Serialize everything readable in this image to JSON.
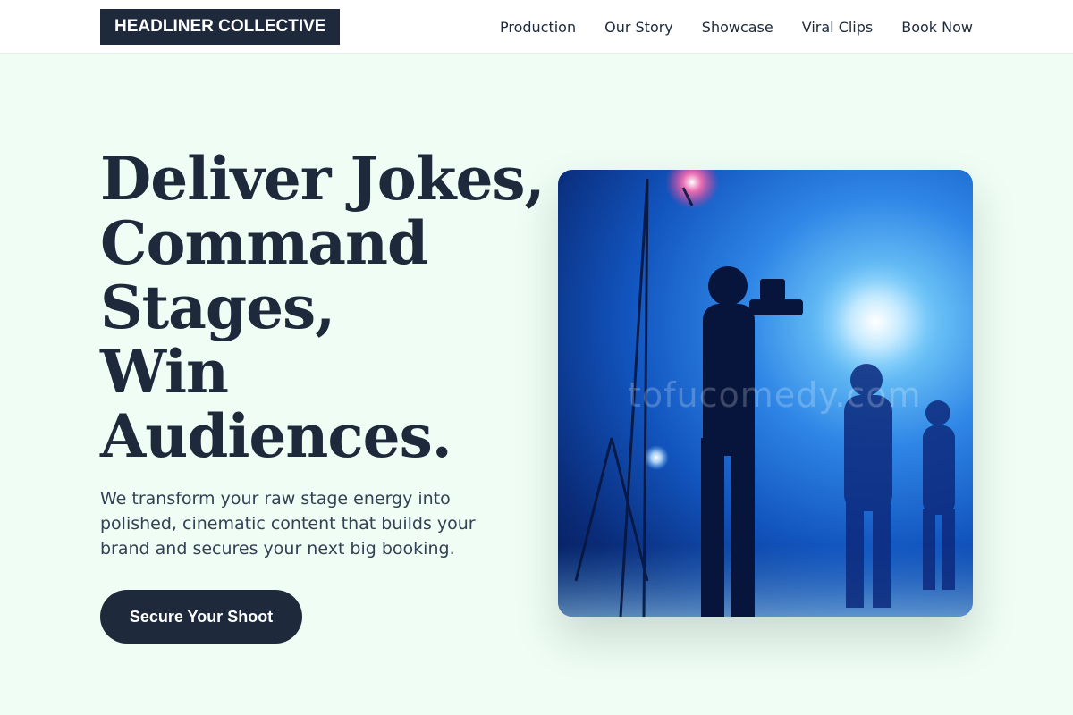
{
  "header": {
    "brand": "HEADLINER COLLECTIVE",
    "nav": [
      {
        "label": "Production"
      },
      {
        "label": "Our Story"
      },
      {
        "label": "Showcase"
      },
      {
        "label": "Viral Clips"
      },
      {
        "label": "Book Now"
      }
    ]
  },
  "hero": {
    "title_lines": [
      "Deliver Jokes,",
      "Command",
      "Stages,",
      "Win",
      "Audiences."
    ],
    "subtitle": "We transform your raw stage energy into polished, cinematic content that builds your brand and secures your next big booking.",
    "cta_label": "Secure Your Shoot",
    "image": {
      "watermark": "tofucomedy.com"
    }
  },
  "colors": {
    "background": "#effdf4",
    "navy": "#1e293b",
    "stage_blue": "#1255bf"
  }
}
